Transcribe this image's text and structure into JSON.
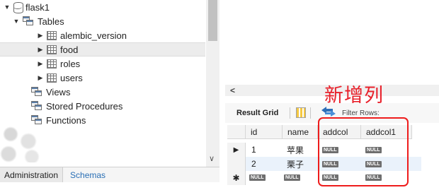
{
  "navigator": {
    "schema": "flask1",
    "tables_folder": "Tables",
    "tables": [
      "alembic_version",
      "food",
      "roles",
      "users"
    ],
    "selected_table": "food",
    "folders": [
      "Views",
      "Stored Procedures",
      "Functions"
    ]
  },
  "bottom_tabs": [
    "Administration",
    "Schemas"
  ],
  "result": {
    "toolbar_label": "Result Grid",
    "filter_label": "Filter Rows:",
    "columns": [
      "id",
      "name",
      "addcol",
      "addcol1"
    ],
    "rows": [
      {
        "id": "1",
        "name": "苹果",
        "addcol": "NULL",
        "addcol1": "NULL"
      },
      {
        "id": "2",
        "name": "栗子",
        "addcol": "NULL",
        "addcol1": "NULL"
      },
      {
        "id": "NULL",
        "name": "NULL",
        "addcol": "NULL",
        "addcol1": "NULL"
      }
    ]
  },
  "annotation": "新增列",
  "colors": {
    "annotation": "#e8202a",
    "selected_row": "#ececec",
    "link_tab": "#2a6fb5"
  }
}
